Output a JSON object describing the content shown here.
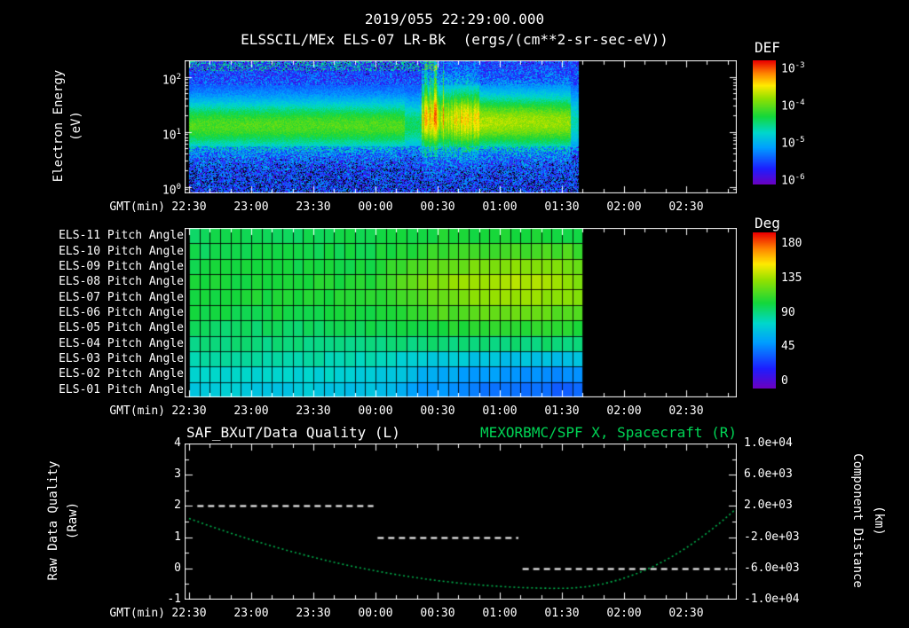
{
  "header": {
    "timestamp": "2019/055 22:29:00.000",
    "title": "ELSSCIL/MEx ELS-07 LR-Bk  (ergs/(cm**2-sr-sec-eV))"
  },
  "colors": {
    "background": "#000000",
    "text": "#ffffff",
    "green": "#00d455"
  },
  "time_axis": {
    "label": "GMT(min)",
    "tick_labels": [
      "22:30",
      "23:00",
      "23:30",
      "00:00",
      "00:30",
      "01:00",
      "01:30",
      "02:00",
      "02:30"
    ],
    "tick_minutes": [
      0,
      30,
      60,
      90,
      120,
      150,
      180,
      210,
      240
    ],
    "tick_interval_min": 30,
    "minor_step_min": 10,
    "total_minutes": 264,
    "data_end_minutes": 188
  },
  "chart_data": [
    {
      "id": "spectrogram",
      "type": "heatmap",
      "instrument_title": "ELSSCIL/MEx ELS-07 LR-Bk",
      "units": "(ergs/(cm**2-sr-sec-eV))",
      "ylabel": "Electron Energy",
      "ylabel_units": "(eV)",
      "y_scale": "log",
      "y_tick_labels": [
        "10^2",
        "10^1",
        "10^0"
      ],
      "y_tick_log_values": [
        2,
        1,
        0
      ],
      "y_range_log": [
        -0.12,
        2.3
      ],
      "colorbar": {
        "label": "DEF",
        "tick_labels": [
          "10^-3",
          "10^-4",
          "10^-5",
          "10^-6"
        ],
        "log10_flux_range": [
          -6,
          -3
        ]
      },
      "features": {
        "main_band": {
          "center_ev": 14,
          "peak_log10_flux": -4.1,
          "width_decades": 0.33
        },
        "enhancement": {
          "start": "00:22",
          "end": "00:50",
          "peak_log10_flux": -3.6,
          "note": "vertical striations, flux extends above 100 eV"
        },
        "elevated_tail": {
          "start": "00:50",
          "end": "01:35",
          "peak_log10_flux": -3.9
        },
        "data_end": "01:38"
      }
    },
    {
      "id": "pitch",
      "type": "heatmap",
      "row_labels": [
        "ELS-11 Pitch Angle",
        "ELS-10 Pitch Angle",
        "ELS-09 Pitch Angle",
        "ELS-08 Pitch Angle",
        "ELS-07 Pitch Angle",
        "ELS-06 Pitch Angle",
        "ELS-05 Pitch Angle",
        "ELS-04 Pitch Angle",
        "ELS-03 Pitch Angle",
        "ELS-02 Pitch Angle",
        "ELS-01 Pitch Angle"
      ],
      "colorbar": {
        "label": "Deg",
        "tick_labels": [
          "180",
          "135",
          "90",
          "45",
          "0"
        ],
        "range_deg": [
          0,
          180
        ]
      },
      "cell_minutes": 5,
      "sample_minutes": [
        0,
        30,
        60,
        90,
        120,
        150,
        180,
        190
      ],
      "values_deg": [
        [
          95,
          95,
          95,
          96,
          100,
          100,
          100,
          100
        ],
        [
          95,
          95,
          96,
          98,
          106,
          110,
          110,
          108
        ],
        [
          98,
          98,
          98,
          100,
          115,
          122,
          121,
          118
        ],
        [
          100,
          100,
          100,
          103,
          121,
          130,
          128,
          122
        ],
        [
          100,
          100,
          100,
          102,
          118,
          126,
          124,
          120
        ],
        [
          98,
          98,
          98,
          100,
          110,
          116,
          114,
          112
        ],
        [
          92,
          92,
          92,
          95,
          101,
          104,
          104,
          102
        ],
        [
          88,
          88,
          88,
          88,
          89,
          90,
          90,
          90
        ],
        [
          82,
          82,
          82,
          79,
          71,
          67,
          66,
          68
        ],
        [
          76,
          76,
          75,
          71,
          59,
          52,
          50,
          52
        ],
        [
          70,
          70,
          69,
          65,
          51,
          42,
          40,
          44
        ]
      ]
    },
    {
      "id": "timeseries",
      "type": "line",
      "title_left": "SAF_BXuT/Data Quality (L)",
      "title_right": "MEXORBMC/SPF X, Spacecraft (R)",
      "left_axis": {
        "label": "Raw Data Quality",
        "units": "(Raw)",
        "tick_labels": [
          "4",
          "3",
          "2",
          "1",
          "0",
          "-1"
        ],
        "tick_values": [
          4,
          3,
          2,
          1,
          0,
          -1
        ],
        "range": [
          -1,
          4
        ]
      },
      "right_axis": {
        "label": "Component Distance",
        "units": "(km)",
        "tick_labels": [
          "1.0e+04",
          "6.0e+03",
          "2.0e+03",
          "-2.0e+03",
          "-6.0e+03",
          "-1.0e+04"
        ],
        "tick_values": [
          10000,
          6000,
          2000,
          -2000,
          -6000,
          -10000
        ],
        "range": [
          -10000,
          10000
        ]
      },
      "series": [
        {
          "name": "SAF_BXuT/Data Quality",
          "axis": "left",
          "color": "#ffffff",
          "line_style": "dashed",
          "segments": [
            {
              "start_min": 4,
              "end_min": 89,
              "value": 2
            },
            {
              "start_min": 91,
              "end_min": 159,
              "value": 1
            },
            {
              "start_min": 161,
              "end_min": 260,
              "value": 0
            }
          ]
        },
        {
          "name": "MEXORBMC/SPF X Spacecraft",
          "axis": "right",
          "color": "#00b34d",
          "line_style": "dotted",
          "points_min_km": [
            [
              0,
              400
            ],
            [
              8,
              -380
            ],
            [
              16,
              -1120
            ],
            [
              24,
              -1830
            ],
            [
              32,
              -2500
            ],
            [
              40,
              -3140
            ],
            [
              48,
              -3740
            ],
            [
              56,
              -4310
            ],
            [
              64,
              -4840
            ],
            [
              72,
              -5340
            ],
            [
              80,
              -5800
            ],
            [
              88,
              -6220
            ],
            [
              96,
              -6610
            ],
            [
              104,
              -6960
            ],
            [
              112,
              -7280
            ],
            [
              120,
              -7570
            ],
            [
              128,
              -7810
            ],
            [
              136,
              -8030
            ],
            [
              144,
              -8200
            ],
            [
              152,
              -8340
            ],
            [
              160,
              -8450
            ],
            [
              168,
              -8520
            ],
            [
              176,
              -8560
            ],
            [
              184,
              -8540
            ],
            [
              192,
              -8350
            ],
            [
              200,
              -7980
            ],
            [
              208,
              -7430
            ],
            [
              216,
              -6690
            ],
            [
              224,
              -5770
            ],
            [
              232,
              -4670
            ],
            [
              240,
              -3380
            ],
            [
              248,
              -1900
            ],
            [
              256,
              -240
            ],
            [
              264,
              1600
            ]
          ]
        }
      ]
    }
  ]
}
